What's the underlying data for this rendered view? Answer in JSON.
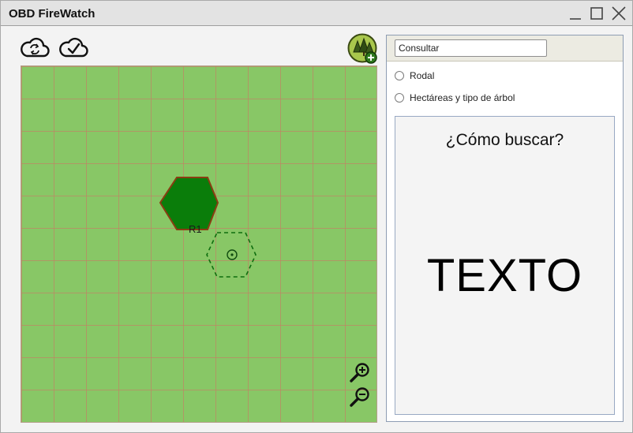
{
  "window": {
    "title": "OBD FireWatch",
    "controls": {
      "minimize": "minimize-icon",
      "maximize": "maximize-icon",
      "close": "close-icon"
    }
  },
  "toolbar": {
    "sync_icon": "cloud-sync-icon",
    "confirm_icon": "cloud-check-icon",
    "forest_icon": "forest-add-icon"
  },
  "map": {
    "background_color": "#88c766",
    "grid_color": "#be8764",
    "hexes": [
      {
        "label": "R1",
        "state": "placed",
        "fill": "#0a7d0a",
        "stroke": "#8a3d12"
      },
      {
        "label": "",
        "state": "placement-preview",
        "stroke": "#0f6e0f"
      }
    ],
    "zoom_in_icon": "zoom-in-icon",
    "zoom_out_icon": "zoom-out-icon"
  },
  "panel": {
    "query": {
      "value": "Consultar",
      "placeholder": ""
    },
    "options": [
      {
        "label": "Rodal",
        "selected": false
      },
      {
        "label": "Hectáreas y tipo de árbol",
        "selected": false
      }
    ],
    "help_title": "¿Cómo buscar?",
    "help_text": "TEXTO"
  }
}
